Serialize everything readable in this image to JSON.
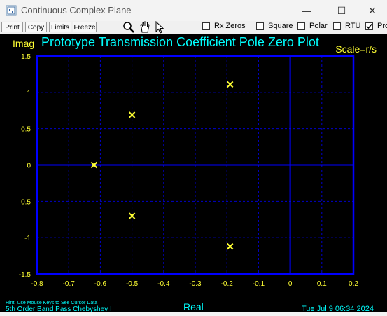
{
  "window": {
    "title": "Continuous Complex Plane",
    "minimize_glyph": "—",
    "maximize_glyph": "☐",
    "close_glyph": "✕"
  },
  "toolbar": {
    "buttons": [
      "Print",
      "Copy",
      "Limits",
      "Freeze"
    ],
    "tools": [
      "zoom-icon",
      "hand-icon",
      "pointer-icon"
    ],
    "checkboxes": [
      {
        "label": "Rx Zeros",
        "checked": false
      },
      {
        "label": "Square",
        "checked": false
      },
      {
        "label": "Polar",
        "checked": false
      },
      {
        "label": "RTU",
        "checked": false
      },
      {
        "label": "Pro",
        "checked": true
      }
    ]
  },
  "plot": {
    "y_axis_name": "Imag",
    "x_axis_name": "Real",
    "scale_label": "Scale=r/s",
    "hint": "Hint: Use Mouse Keys to See Cursor Data",
    "filter_description": "5th Order Band Pass Chebyshev I",
    "timestamp": "Tue Jul  9 06:34 2024",
    "colors": {
      "background": "#000000",
      "frame": "#0000ff",
      "grid": "#0000cc",
      "ticks": "#ffff33",
      "title": "#00ffff",
      "marker": "#ffff33"
    }
  },
  "chart_data": {
    "type": "scatter",
    "title": "Prototype Transmission Coefficient Pole Zero Plot",
    "xlabel": "Real",
    "ylabel": "Imag",
    "xlim": [
      -0.8,
      0.2
    ],
    "ylim": [
      -1.5,
      1.5
    ],
    "x_ticks": [
      "-0.8",
      "-0.7",
      "-0.6",
      "-0.5",
      "-0.4",
      "-0.3",
      "-0.2",
      "-0.1",
      "0",
      "0.1",
      "0.2"
    ],
    "y_ticks": [
      "1.5",
      "1",
      "0.5",
      "0",
      "-0.5",
      "-1",
      "-1.5"
    ],
    "grid": true,
    "series": [
      {
        "marker": "x",
        "points": [
          {
            "x": -0.62,
            "y": 0
          },
          {
            "x": -0.5,
            "y": 0.69
          },
          {
            "x": -0.5,
            "y": -0.7
          },
          {
            "x": -0.19,
            "y": 1.11
          },
          {
            "x": -0.19,
            "y": -1.12
          }
        ]
      }
    ]
  }
}
